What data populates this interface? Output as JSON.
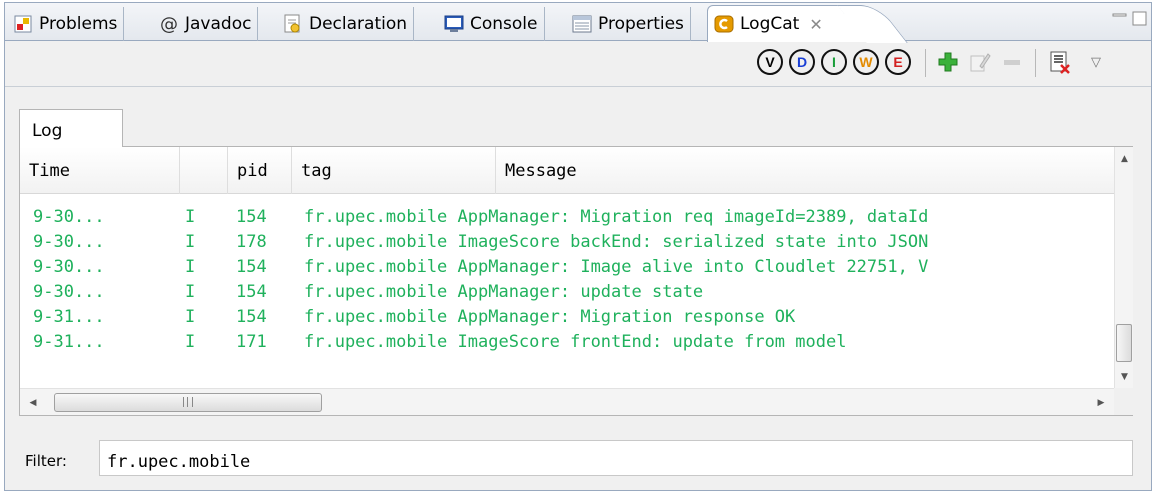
{
  "tabs": [
    {
      "label": "Problems",
      "icon": "problems-icon",
      "active": false
    },
    {
      "label": "Javadoc",
      "icon": "javadoc-icon",
      "active": false
    },
    {
      "label": "Declaration",
      "icon": "declaration-icon",
      "active": false
    },
    {
      "label": "Console",
      "icon": "console-icon",
      "active": false
    },
    {
      "label": "Properties",
      "icon": "properties-icon",
      "active": false
    },
    {
      "label": "LogCat",
      "icon": "logcat-icon",
      "active": true
    }
  ],
  "javadoc_glyph": "@",
  "close_glyph": "✕",
  "toolbar": {
    "levels": [
      {
        "letter": "V",
        "name": "verbose",
        "color": "#000000"
      },
      {
        "letter": "D",
        "name": "debug",
        "color": "#1a3fd6"
      },
      {
        "letter": "I",
        "name": "info",
        "color": "#1a9e3a"
      },
      {
        "letter": "W",
        "name": "warn",
        "color": "#e38b00"
      },
      {
        "letter": "E",
        "name": "error",
        "color": "#d21f1f"
      }
    ],
    "menu_glyph": "▽"
  },
  "inner_tab": {
    "label": "Log"
  },
  "table": {
    "columns": [
      "Time",
      "",
      "pid",
      "tag",
      "Message"
    ],
    "row_color": "#1fb15c",
    "rows": [
      {
        "time": "9-30...",
        "level": "I",
        "pid": "154",
        "text": "fr.upec.mobile AppManager: Migration req imageId=2389, dataId"
      },
      {
        "time": "9-30...",
        "level": "I",
        "pid": "178",
        "text": "fr.upec.mobile ImageScore backEnd: serialized state into JSON"
      },
      {
        "time": "9-30...",
        "level": "I",
        "pid": "154",
        "text": "fr.upec.mobile AppManager: Image alive into Cloudlet 22751, V"
      },
      {
        "time": "9-30...",
        "level": "I",
        "pid": "154",
        "text": "fr.upec.mobile AppManager: update state"
      },
      {
        "time": "9-31...",
        "level": "I",
        "pid": "154",
        "text": "fr.upec.mobile AppManager: Migration response OK"
      },
      {
        "time": "9-31...",
        "level": "I",
        "pid": "171",
        "text": "fr.upec.mobile ImageScore frontEnd: update from model"
      }
    ]
  },
  "filter": {
    "label": "Filter:",
    "value": "fr.upec.mobile"
  }
}
